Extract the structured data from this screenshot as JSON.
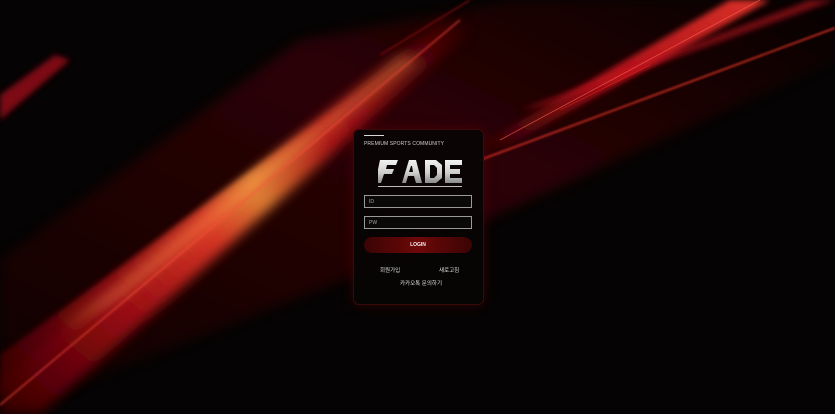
{
  "tagline": "PREMIUM SPORTS COMMUNITY",
  "brand": {
    "logo_text": "FADE",
    "colors": {
      "accent_red": "#c8141e",
      "button_red": "#6e0808",
      "logo_silver": "#d9d9d9"
    }
  },
  "login_form": {
    "id_placeholder": "ID",
    "pw_placeholder": "PW",
    "login_label": "LOGIN"
  },
  "links": {
    "signup": "회원가입",
    "new": "새로고침",
    "kakao": "카카오톡 문의하기"
  }
}
